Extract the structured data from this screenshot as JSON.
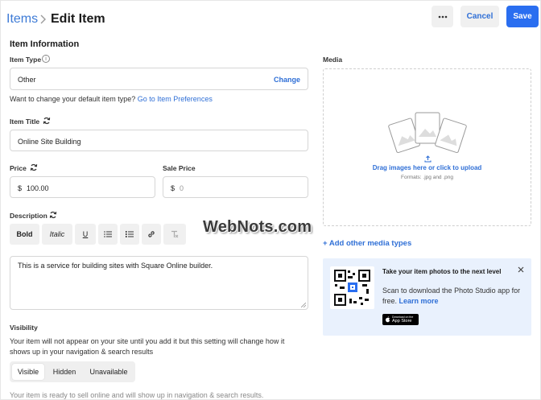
{
  "header": {
    "breadcrumb": "Items",
    "title": "Edit Item",
    "more_label": "···",
    "cancel_label": "Cancel",
    "save_label": "Save"
  },
  "form": {
    "section_title": "Item Information",
    "item_type": {
      "label": "Item Type",
      "value": "Other",
      "change_label": "Change",
      "hint": "Want to change your default item type?",
      "hint_link": "Go to Item Preferences"
    },
    "item_title": {
      "label": "Item Title",
      "value": "Online Site Building"
    },
    "price": {
      "label": "Price",
      "currency": "$",
      "value": "100.00"
    },
    "sale_price": {
      "label": "Sale Price",
      "currency": "$",
      "placeholder": "0"
    },
    "description": {
      "label": "Description",
      "toolbar": [
        "Bold",
        "Italic",
        "U"
      ],
      "value": "This is a service for building sites with Square Online builder."
    },
    "visibility": {
      "label": "Visibility",
      "help": "Your item will not appear on your site until you add it but this setting will change how it",
      "help2": "shows up in your navigation & search results",
      "options": [
        "Visible",
        "Hidden",
        "Unavailable"
      ],
      "selected": "Visible",
      "footer": "Your item is ready to sell online and will show up in navigation & search results."
    }
  },
  "media": {
    "label": "Media",
    "upload_text": "Drag images here or click to upload",
    "formats": "Formats: .jpg and .png",
    "add_other": "+ Add other media types"
  },
  "promo": {
    "title": "Take your item photos to the next level",
    "body": "Scan to download the Photo Studio app for",
    "body2": "free.",
    "learn_more": "Learn more",
    "store_small": "Download on the",
    "store_big": "App Store"
  },
  "watermark": "WebNots.com",
  "colors": {
    "accent": "#2a6ef0",
    "link": "#2f6fd6",
    "promo_bg": "#e9f1fd"
  }
}
